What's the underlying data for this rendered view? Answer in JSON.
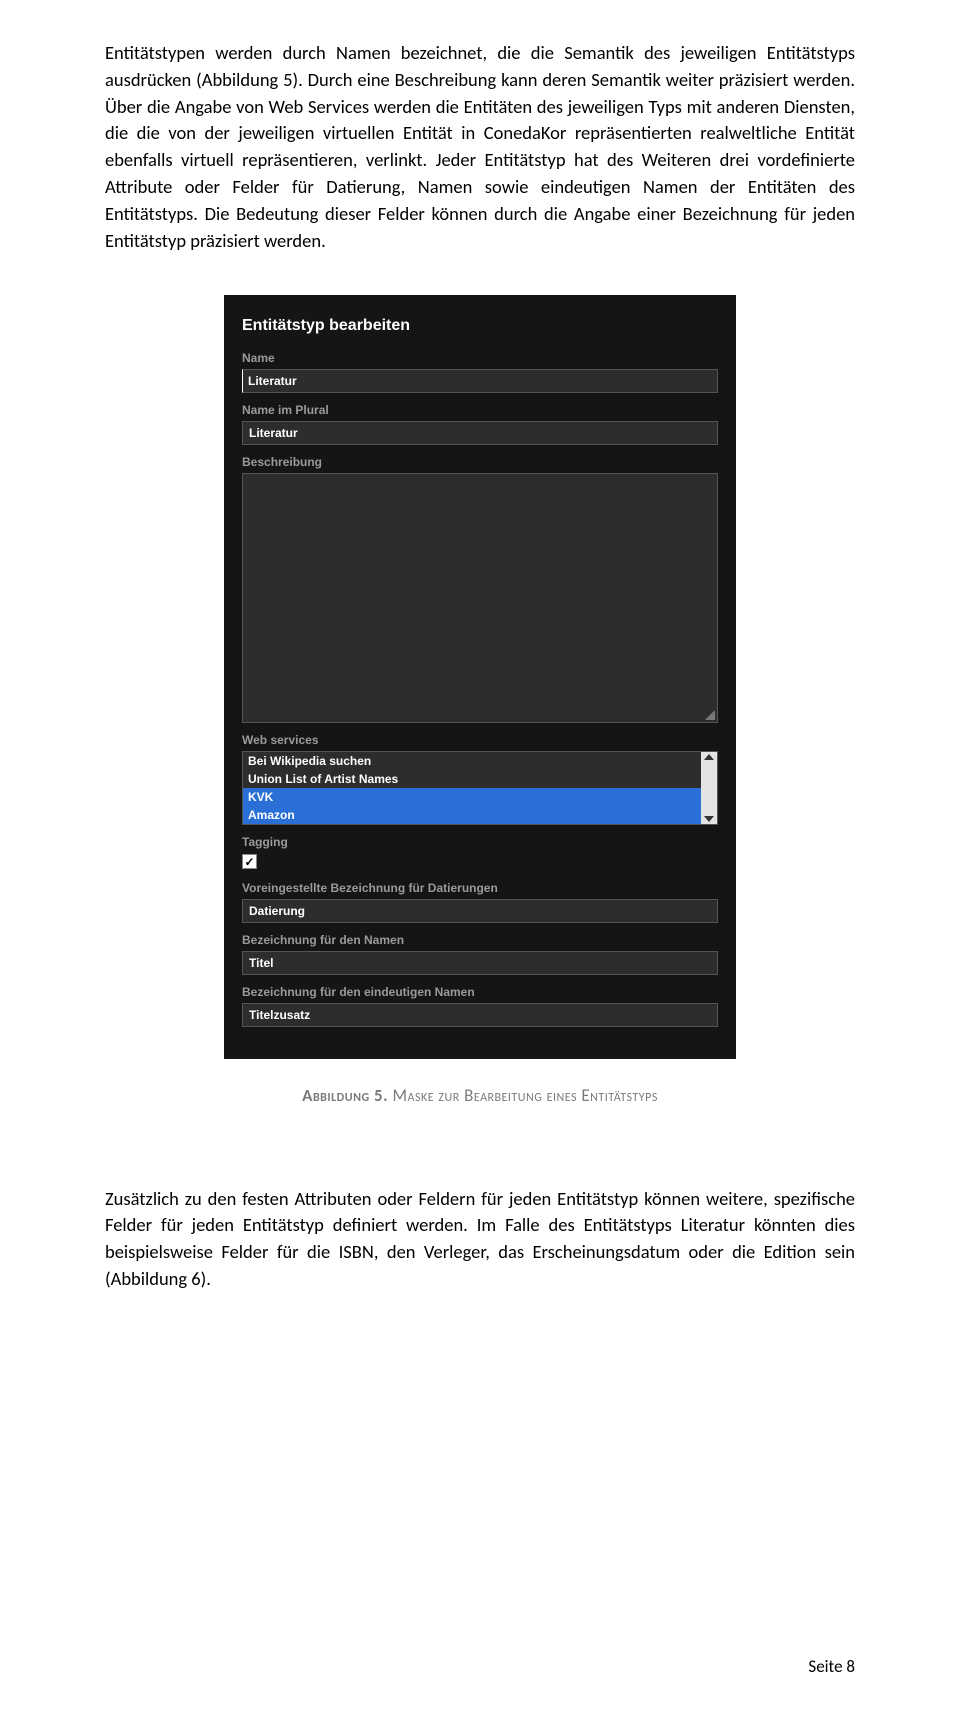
{
  "paragraph1": "Entitätstypen werden durch Namen bezeichnet, die die Semantik des jeweiligen Entitätstyps ausdrücken (Abbildung 5). Durch eine Beschreibung kann deren Semantik weiter präzisiert werden. Über die Angabe von Web Services werden die Entitäten des jeweiligen Typs mit anderen Diensten, die die von der jeweiligen virtuellen Entität in ConedaKor repräsentierten realweltliche Entität ebenfalls virtuell repräsentieren, verlinkt. Jeder Entitätstyp hat des Weiteren drei vordefinierte Attribute oder Felder für Datierung, Namen sowie eindeutigen Namen der Entitäten des Entitätstyps. Die Bedeutung dieser Felder können durch die Angabe einer Bezeichnung für jeden Entitätstyp präzisiert werden.",
  "form": {
    "title": "Entitätstyp bearbeiten",
    "labels": {
      "name": "Name",
      "name_plural": "Name im Plural",
      "beschreibung": "Beschreibung",
      "web_services": "Web services",
      "tagging": "Tagging",
      "datierung": "Voreingestellte Bezeichnung für Datierungen",
      "namen": "Bezeichnung für den Namen",
      "eindeutig": "Bezeichnung für den eindeutigen Namen"
    },
    "values": {
      "name": "Literatur",
      "name_plural": "Literatur",
      "datierung": "Datierung",
      "namen": "Titel",
      "eindeutig": "Titelzusatz"
    },
    "web_services": [
      "Bei Wikipedia suchen",
      "Union List of Artist Names",
      "KVK",
      "Amazon"
    ],
    "web_services_selected": [
      2,
      3
    ],
    "tagging_checked": "✓"
  },
  "caption_label": "Abbildung 5.",
  "caption_text": " Maske zur Bearbeitung eines Entitätstyps",
  "paragraph2_a": "Zusätzlich zu den festen Attributen oder Feldern für jeden Entitätstyp können weitere, spezifische Felder für jeden Entitätstyp definiert werden. Im Falle des Entitätstyps ",
  "paragraph2_italic": "Literatur",
  "paragraph2_b": " könnten dies beispielsweise Felder für die ISBN, den Verleger, das Erscheinungsdatum oder die Edition sein (Abbildung 6).",
  "page_number": "Seite 8"
}
